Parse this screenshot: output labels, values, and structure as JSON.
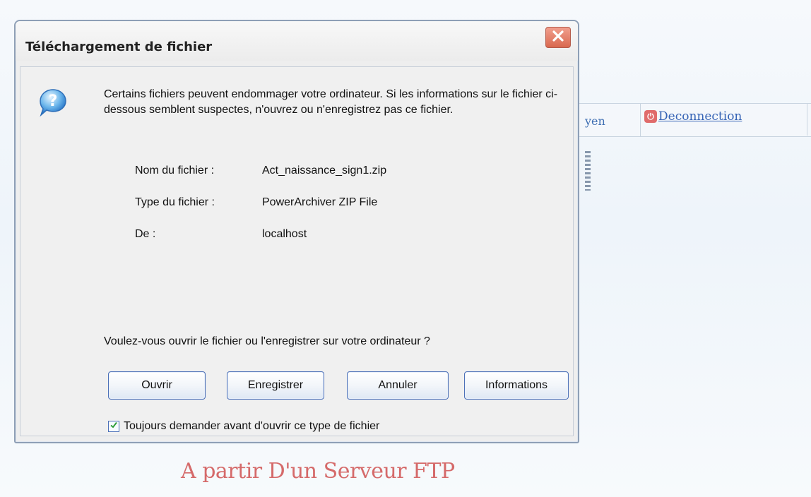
{
  "background": {
    "nav_left_text": "yen",
    "deconnection_label": "Deconnection",
    "caption": "A partir D'un Serveur FTP"
  },
  "dialog": {
    "title": "Téléchargement de fichier",
    "warning": "Certains fichiers peuvent endommager votre ordinateur. Si les informations sur le fichier ci-dessous semblent suspectes, n'ouvrez ou n'enregistrez pas ce fichier.",
    "info_rows": [
      {
        "label": "Nom du fichier :",
        "value": "Act_naissance_sign1.zip"
      },
      {
        "label": "Type du fichier :",
        "value": "PowerArchiver ZIP File"
      },
      {
        "label": "De :",
        "value": "localhost"
      }
    ],
    "question": "Voulez-vous ouvrir le fichier ou l'enregistrer sur votre ordinateur ?",
    "buttons": {
      "open": "Ouvrir",
      "save": "Enregistrer",
      "cancel": "Annuler",
      "info": "Informations"
    },
    "checkbox": {
      "label": "Toujours demander avant d'ouvrir ce type de fichier",
      "checked": true
    }
  },
  "colors": {
    "dialog_background": "#eeeeee",
    "button_border": "#4d71b8",
    "caption_red": "#d56a6a",
    "close_red": "#d9684f"
  },
  "icons": {
    "dialog": "question-icon",
    "close": "close-icon",
    "checkbox": "checkmark-icon",
    "logout": "power-icon"
  }
}
